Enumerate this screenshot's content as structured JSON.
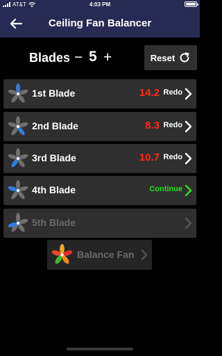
{
  "status": {
    "carrier": "AT&T",
    "time": "4:03 PM"
  },
  "nav": {
    "title": "Ceiling Fan Balancer"
  },
  "blades": {
    "label": "Blades",
    "minus": "−",
    "count": "5",
    "plus": "+"
  },
  "reset": {
    "label": "Reset"
  },
  "rows": [
    {
      "label": "1st Blade",
      "value": "14.2",
      "action": "Redo"
    },
    {
      "label": "2nd Blade",
      "value": "8.3",
      "action": "Redo"
    },
    {
      "label": "3rd Blade",
      "value": "10.7",
      "action": "Redo"
    },
    {
      "label": "4th Blade",
      "action": "Continue"
    },
    {
      "label": "5th Blade"
    }
  ],
  "balance": {
    "label": "Balance Fan"
  },
  "colors": {
    "nav_bg": "#272a52",
    "value_red": "#ff2a17",
    "continue_green": "#22e31a",
    "blade_blue": "#2f7de1",
    "blade_gray": "#6f6f6f"
  }
}
